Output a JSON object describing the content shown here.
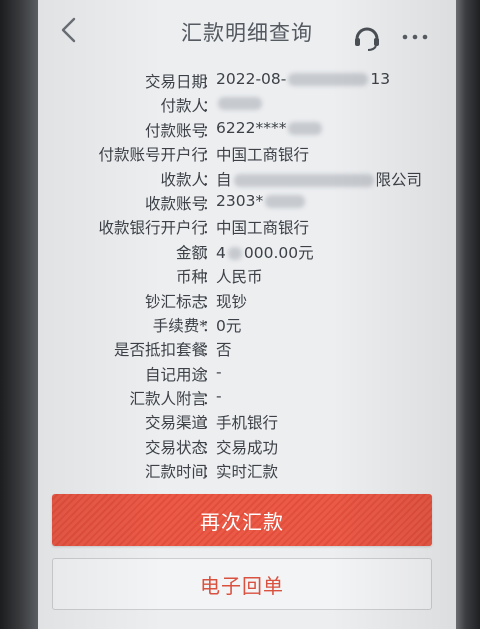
{
  "header": {
    "title": "汇款明细查询",
    "back_icon": "chevron-left-icon",
    "support_icon": "headset-icon",
    "more_icon": "more-dots-icon"
  },
  "details": [
    {
      "label": "交易日期",
      "value_start": "2022-08-",
      "value_end": "13"
    },
    {
      "label": "付款人",
      "value_start": "",
      "value_end": ""
    },
    {
      "label": "付款账号",
      "value_start": "6222****",
      "value_end": ""
    },
    {
      "label": "付款账号开户行",
      "value_start": "中国工商银行",
      "value_end": ""
    },
    {
      "label": "收款人",
      "value_start": "自",
      "value_end": "限公司"
    },
    {
      "label": "收款账号",
      "value_start": "2303*",
      "value_end": ""
    },
    {
      "label": "收款银行开户行",
      "value_start": "中国工商银行",
      "value_end": ""
    },
    {
      "label": "金额",
      "value_start": "4",
      "value_end": "000.00元"
    },
    {
      "label": "币种",
      "value_start": "人民币",
      "value_end": ""
    },
    {
      "label": "钞汇标志",
      "value_start": "现钞",
      "value_end": ""
    },
    {
      "label": "手续费*",
      "value_start": "0元",
      "value_end": ""
    },
    {
      "label": "是否抵扣套餐",
      "value_start": "否",
      "value_end": ""
    },
    {
      "label": "自记用途",
      "value_start": "-",
      "value_end": ""
    },
    {
      "label": "汇款人附言",
      "value_start": "-",
      "value_end": ""
    },
    {
      "label": "交易渠道",
      "value_start": "手机银行",
      "value_end": ""
    },
    {
      "label": "交易状态",
      "value_start": "交易成功",
      "value_end": ""
    },
    {
      "label": "汇款时间",
      "value_start": "实时汇款",
      "value_end": ""
    }
  ],
  "colon": "：",
  "actions": {
    "primary_label": "再次汇款",
    "secondary_label": "电子回单"
  },
  "colors": {
    "accent": "#e8503f",
    "text": "#3d4147",
    "title": "#555a61",
    "background": "#eceef0"
  }
}
